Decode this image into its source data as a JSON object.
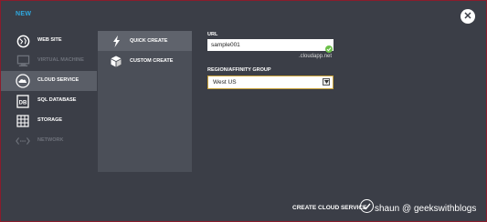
{
  "header": {
    "title": "NEW",
    "close_icon": "close-icon"
  },
  "categories": [
    {
      "label": "WEB SITE",
      "icon": "web-site-icon",
      "enabled": true,
      "selected": false
    },
    {
      "label": "VIRTUAL MACHINE",
      "icon": "virtual-machine-icon",
      "enabled": false,
      "selected": false
    },
    {
      "label": "CLOUD SERVICE",
      "icon": "cloud-service-icon",
      "enabled": true,
      "selected": true
    },
    {
      "label": "SQL DATABASE",
      "icon": "sql-database-icon",
      "enabled": true,
      "selected": false
    },
    {
      "label": "STORAGE",
      "icon": "storage-icon",
      "enabled": true,
      "selected": false
    },
    {
      "label": "NETWORK",
      "icon": "network-icon",
      "enabled": false,
      "selected": false
    }
  ],
  "submenu": [
    {
      "label": "QUICK CREATE",
      "icon": "lightning-icon",
      "selected": true
    },
    {
      "label": "CUSTOM CREATE",
      "icon": "cube-icon",
      "selected": false
    }
  ],
  "form": {
    "url_label": "URL",
    "url_value": "sample001",
    "url_suffix": ".cloudapp.net",
    "region_label": "REGION/AFFINITY GROUP",
    "region_value": "West US"
  },
  "footer": {
    "create_label": "CREATE CLOUD SERVICE",
    "create_icon": "checkmark-icon"
  },
  "watermark": "shaun @ geekswithblogs",
  "colors": {
    "accent": "#2fa8df",
    "background": "#3b3e47",
    "submenu_bg": "#4b4f58",
    "selected_bg": "#5a5e67",
    "valid": "#6cc04a"
  }
}
